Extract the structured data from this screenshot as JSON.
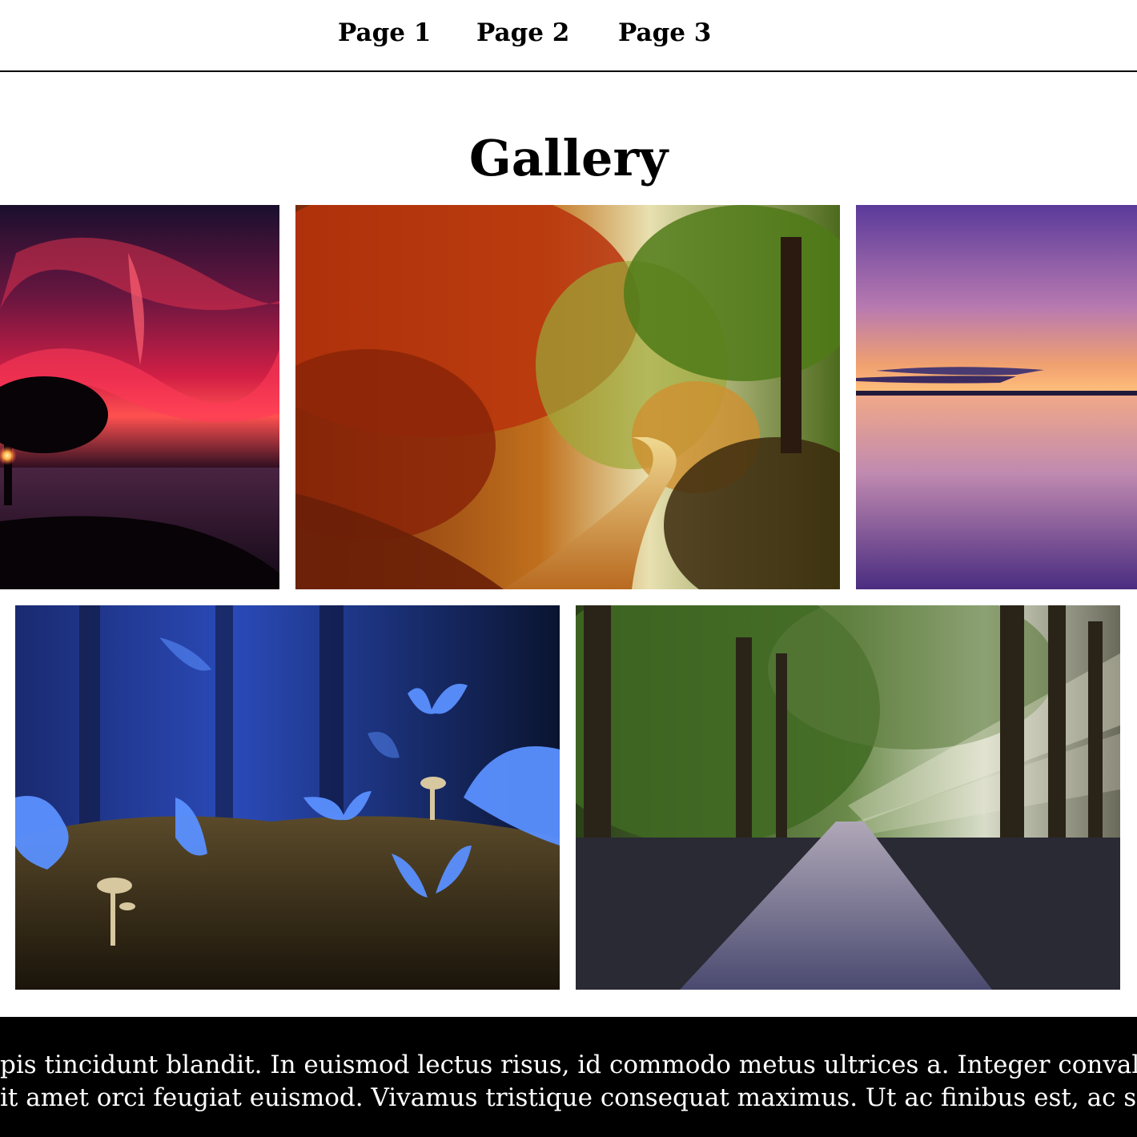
{
  "nav": {
    "links": [
      "Page 1",
      "Page 2",
      "Page 3"
    ]
  },
  "main": {
    "title": "Gallery",
    "images": [
      {
        "subject": "tree-silhouette-red-sky-sunset"
      },
      {
        "subject": "autumn-forest-path"
      },
      {
        "subject": "calm-lake-purple-dusk"
      },
      {
        "subject": "blue-butterflies-mushrooms"
      },
      {
        "subject": "forest-road-sunbeams"
      }
    ]
  },
  "footer": {
    "line1": "pis tincidunt blandit. In euismod lectus risus, id commodo metus ultrices a. Integer convallis bla",
    "line2": "it amet orci feugiat euismod. Vivamus tristique consequat maximus. Ut ac finibus est, ac suscipit"
  }
}
